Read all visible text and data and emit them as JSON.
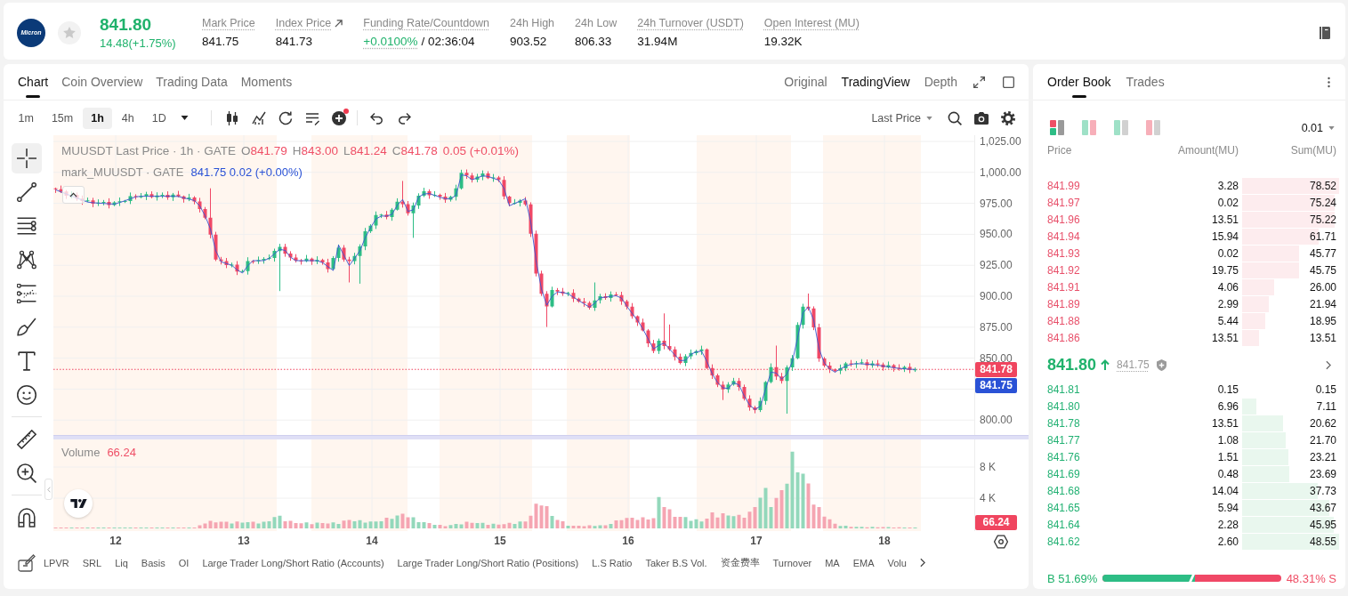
{
  "ticker": {
    "logo_text": "Micron",
    "favorite": false,
    "price": "841.80",
    "change": "14.48(+1.75%)",
    "rising": true,
    "stats": [
      {
        "kind": "plain",
        "label": "Mark Price",
        "value": "841.75",
        "hint": true
      },
      {
        "kind": "link",
        "label": "Index Price",
        "value": "841.73",
        "hint": true
      },
      {
        "kind": "funding",
        "label": "Funding Rate/Countdown",
        "value": "+0.0100%",
        "countdown": "/ 02:36:04",
        "hint": true
      },
      {
        "kind": "plain",
        "label": "24h High",
        "value": "903.52",
        "hint": false
      },
      {
        "kind": "plain",
        "label": "24h Low",
        "value": "806.33",
        "hint": false
      },
      {
        "kind": "plain",
        "label": "24h Turnover (USDT)",
        "value": "31.94M",
        "hint": true
      },
      {
        "kind": "plain",
        "label": "Open Interest (MU)",
        "value": "19.32K",
        "hint": true
      }
    ]
  },
  "chart": {
    "tabs": [
      {
        "label": "Chart",
        "selected": true
      },
      {
        "label": "Coin Overview",
        "selected": false
      },
      {
        "label": "Trading Data",
        "selected": false
      },
      {
        "label": "Moments",
        "selected": false
      }
    ],
    "views": [
      {
        "label": "Original",
        "selected": false
      },
      {
        "label": "TradingView",
        "selected": true
      },
      {
        "label": "Depth",
        "selected": false
      }
    ],
    "intervals": [
      {
        "label": "1m",
        "selected": false
      },
      {
        "label": "15m",
        "selected": false
      },
      {
        "label": "1h",
        "selected": true
      },
      {
        "label": "4h",
        "selected": false
      },
      {
        "label": "1D",
        "selected": false
      }
    ],
    "indicator_badge": true,
    "price_source": "Last Price",
    "drawing_tools": [
      [
        {
          "kind": "crosshair",
          "selected": true
        },
        {
          "kind": "trend-line",
          "selected": false
        },
        {
          "kind": "parallel-lines",
          "selected": false
        },
        {
          "kind": "pattern",
          "selected": false
        },
        {
          "kind": "fib",
          "selected": false
        },
        {
          "kind": "brush",
          "selected": false
        },
        {
          "kind": "text",
          "selected": false
        },
        {
          "kind": "emoji",
          "selected": false
        }
      ],
      [
        {
          "kind": "ruler",
          "selected": false
        },
        {
          "kind": "zoom",
          "selected": false
        }
      ],
      [
        {
          "kind": "magnet",
          "selected": false
        }
      ]
    ],
    "legend": {
      "title": "MUUSDT Last Price · 1h · GATE",
      "ohlc": [
        {
          "key": "O",
          "value": "841.79"
        },
        {
          "key": "H",
          "value": "843.00"
        },
        {
          "key": "L",
          "value": "841.24"
        },
        {
          "key": "C",
          "value": "841.78"
        }
      ],
      "change": "0.05 (+0.01%)",
      "rising": false,
      "mark_title": "mark_MUUSDT · GATE",
      "mark_values": "841.75 0.02 (+0.00%)"
    },
    "price_axis": [
      "1,025.00",
      "1,000.00",
      "975.00",
      "950.00",
      "925.00",
      "900.00",
      "875.00",
      "850.00",
      "800.00"
    ],
    "price_badges": [
      {
        "kind": "last",
        "text": "841.78"
      },
      {
        "kind": "mark",
        "text": "841.75"
      }
    ],
    "volume": {
      "label": "Volume",
      "value": "66.24",
      "rising": false,
      "axis": [
        "8 K",
        "4 K"
      ],
      "badge": "66.24"
    },
    "time_axis": [
      "12",
      "13",
      "14",
      "15",
      "16",
      "17",
      "18"
    ],
    "indicators": [
      "LPVR",
      "SRL",
      "Liq",
      "Basis",
      "OI",
      "Large Trader Long/Short Ratio (Accounts)",
      "Large Trader Long/Short Ratio (Positions)",
      "L.S Ratio",
      "Taker B.S Vol.",
      "资金费率",
      "Turnover",
      "MA",
      "EMA",
      "Volu"
    ]
  },
  "order_book": {
    "tabs": [
      {
        "label": "Order Book",
        "selected": true
      },
      {
        "label": "Trades",
        "selected": false
      }
    ],
    "layouts": [
      {
        "kind": "both",
        "selected": true
      },
      {
        "kind": "split",
        "selected": false
      },
      {
        "kind": "bids",
        "selected": false
      },
      {
        "kind": "asks",
        "selected": false
      }
    ],
    "precision": "0.01",
    "columns": [
      "Price",
      "Amount(MU)",
      "Sum(MU)"
    ],
    "asks": [
      {
        "price": "841.99",
        "amount": "3.28",
        "sum": "78.52"
      },
      {
        "price": "841.97",
        "amount": "0.02",
        "sum": "75.24"
      },
      {
        "price": "841.96",
        "amount": "13.51",
        "sum": "75.22"
      },
      {
        "price": "841.94",
        "amount": "15.94",
        "sum": "61.71"
      },
      {
        "price": "841.93",
        "amount": "0.02",
        "sum": "45.77"
      },
      {
        "price": "841.92",
        "amount": "19.75",
        "sum": "45.75"
      },
      {
        "price": "841.91",
        "amount": "4.06",
        "sum": "26.00"
      },
      {
        "price": "841.89",
        "amount": "2.99",
        "sum": "21.94"
      },
      {
        "price": "841.88",
        "amount": "5.44",
        "sum": "18.95"
      },
      {
        "price": "841.86",
        "amount": "13.51",
        "sum": "13.51"
      }
    ],
    "last": {
      "price": "841.80",
      "rising": true,
      "mark": "841.75"
    },
    "bids": [
      {
        "price": "841.81",
        "amount": "0.15",
        "sum": "0.15"
      },
      {
        "price": "841.80",
        "amount": "6.96",
        "sum": "7.11"
      },
      {
        "price": "841.78",
        "amount": "13.51",
        "sum": "20.62"
      },
      {
        "price": "841.77",
        "amount": "1.08",
        "sum": "21.70"
      },
      {
        "price": "841.76",
        "amount": "1.51",
        "sum": "23.21"
      },
      {
        "price": "841.69",
        "amount": "0.48",
        "sum": "23.69"
      },
      {
        "price": "841.68",
        "amount": "14.04",
        "sum": "37.73"
      },
      {
        "price": "841.65",
        "amount": "5.94",
        "sum": "43.67"
      },
      {
        "price": "841.64",
        "amount": "2.28",
        "sum": "45.95"
      },
      {
        "price": "841.62",
        "amount": "2.60",
        "sum": "48.55"
      }
    ],
    "ratio": {
      "buy": "B 51.69%",
      "sell": "48.31% S",
      "level": 0.5169
    }
  }
}
